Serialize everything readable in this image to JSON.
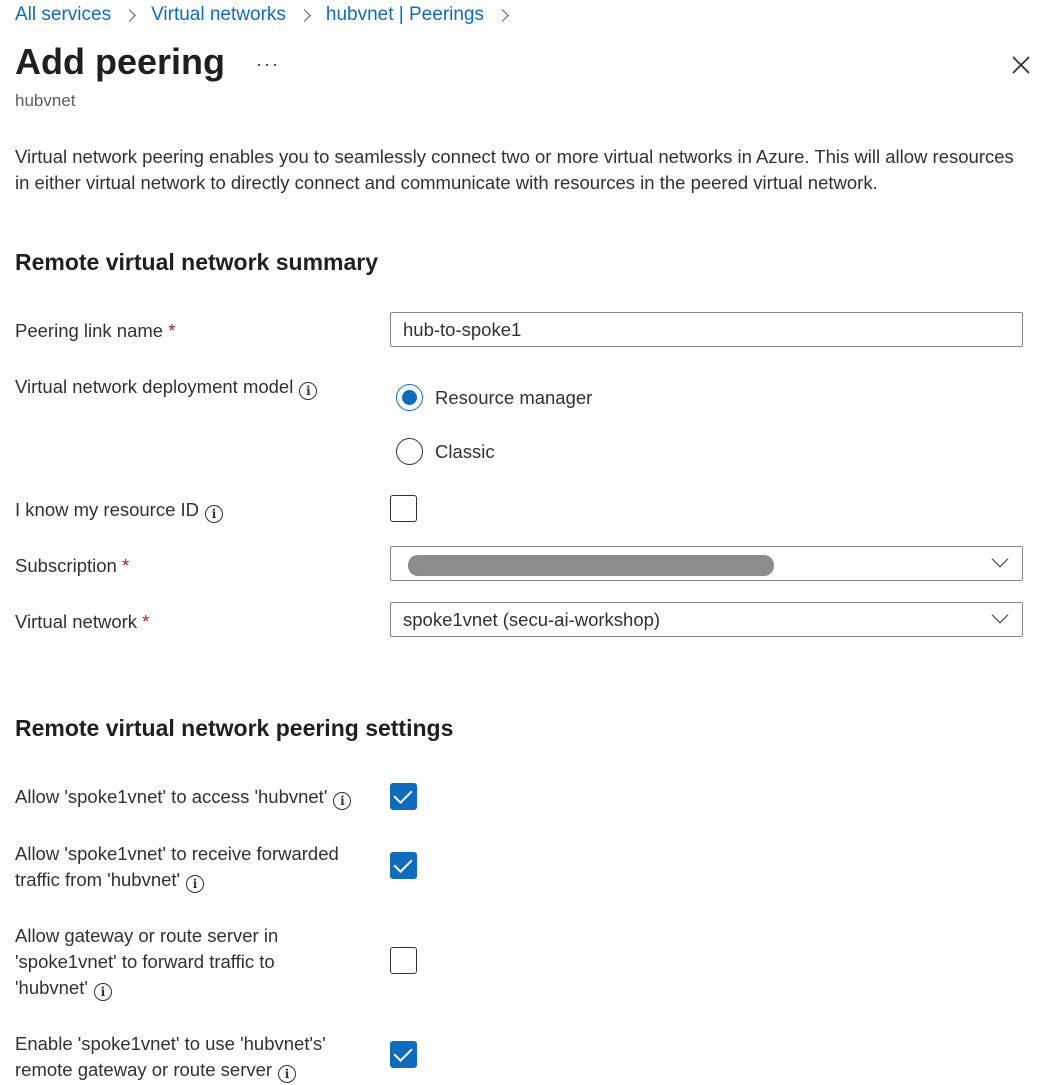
{
  "breadcrumb": [
    "All services",
    "Virtual networks",
    "hubvnet | Peerings"
  ],
  "header": {
    "title": "Add peering",
    "more_label": "···",
    "subtitle": "hubvnet"
  },
  "description": "Virtual network peering enables you to seamlessly connect two or more virtual networks in Azure. This will allow resources in either virtual network to directly connect and communicate with resources in the peered virtual network.",
  "summary": {
    "heading": "Remote virtual network summary",
    "peering_link_name": {
      "label": "Peering link name",
      "required_mark": "*",
      "value": "hub-to-spoke1"
    },
    "deployment_model": {
      "label": "Virtual network deployment model",
      "options": [
        {
          "label": "Resource manager",
          "selected": true
        },
        {
          "label": "Classic",
          "selected": false
        }
      ]
    },
    "know_resource_id": {
      "label": "I know my resource ID",
      "checked": false
    },
    "subscription": {
      "label": "Subscription",
      "required_mark": "*",
      "value": ""
    },
    "virtual_network": {
      "label": "Virtual network",
      "required_mark": "*",
      "value": "spoke1vnet (secu-ai-workshop)"
    }
  },
  "settings": {
    "heading": "Remote virtual network peering settings",
    "options": [
      {
        "label": "Allow 'spoke1vnet' to access 'hubvnet'",
        "checked": true
      },
      {
        "label": "Allow 'spoke1vnet' to receive forwarded traffic from 'hubvnet'",
        "checked": true
      },
      {
        "label": "Allow gateway or route server in 'spoke1vnet' to forward traffic to 'hubvnet'",
        "checked": false
      },
      {
        "label": "Enable 'spoke1vnet' to use 'hubvnet's' remote gateway or route server",
        "checked": true
      }
    ]
  },
  "info_glyph": "i",
  "colors": {
    "accent": "#0f6cbd",
    "required": "#a4262c",
    "text": "#323130"
  }
}
